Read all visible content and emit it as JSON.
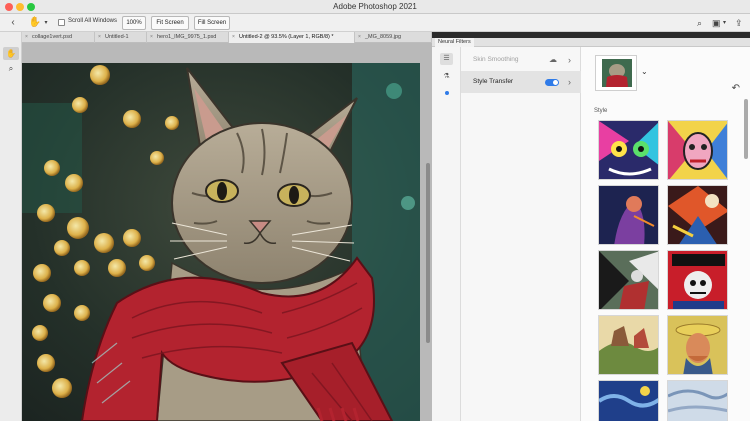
{
  "window": {
    "title": "Adobe Photoshop 2021"
  },
  "options_bar": {
    "scroll_all_label": "Scroll All Windows",
    "zoom_100_label": "100%",
    "fit_screen_label": "Fit Screen",
    "fill_screen_label": "Fill Screen"
  },
  "tabs": [
    {
      "label": "collage1vert.psd",
      "active": false
    },
    {
      "label": "Untitled-1",
      "active": false
    },
    {
      "label": "hero1_IMG_9975_1.psd",
      "active": false
    },
    {
      "label": "Untitled-2 @ 93.5% (Layer 1, RGB/8) *",
      "active": true
    },
    {
      "label": "_MG_8059.jpg",
      "active": false
    }
  ],
  "neural_filters": {
    "panel_title": "Neural Filters",
    "filters": [
      {
        "label": "Skin Smoothing",
        "enabled": false
      },
      {
        "label": "Style Transfer",
        "enabled": true
      }
    ],
    "style_section_label": "Style"
  },
  "colors": {
    "accent": "#2f7be8",
    "scarf_red": "#b3232f"
  }
}
